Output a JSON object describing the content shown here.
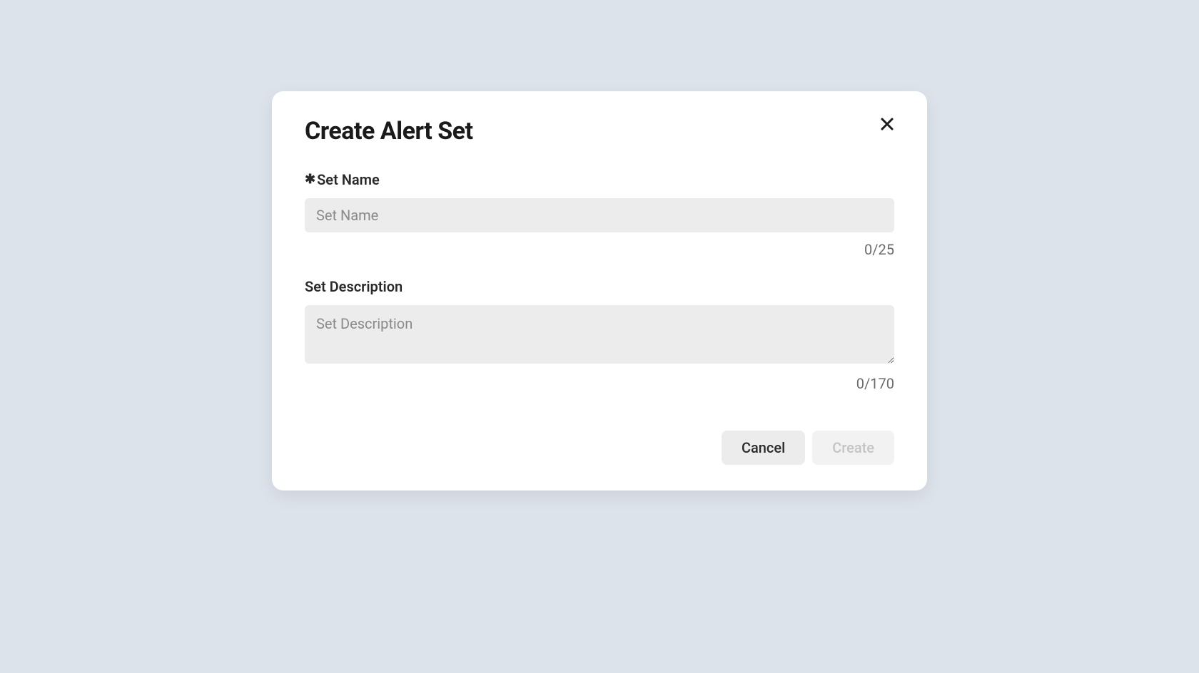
{
  "modal": {
    "title": "Create Alert Set",
    "fields": {
      "name": {
        "label": "Set Name",
        "placeholder": "Set Name",
        "value": "",
        "counter": "0/25",
        "required": true
      },
      "description": {
        "label": "Set Description",
        "placeholder": "Set Description",
        "value": "",
        "counter": "0/170"
      }
    },
    "buttons": {
      "cancel": "Cancel",
      "create": "Create"
    }
  }
}
